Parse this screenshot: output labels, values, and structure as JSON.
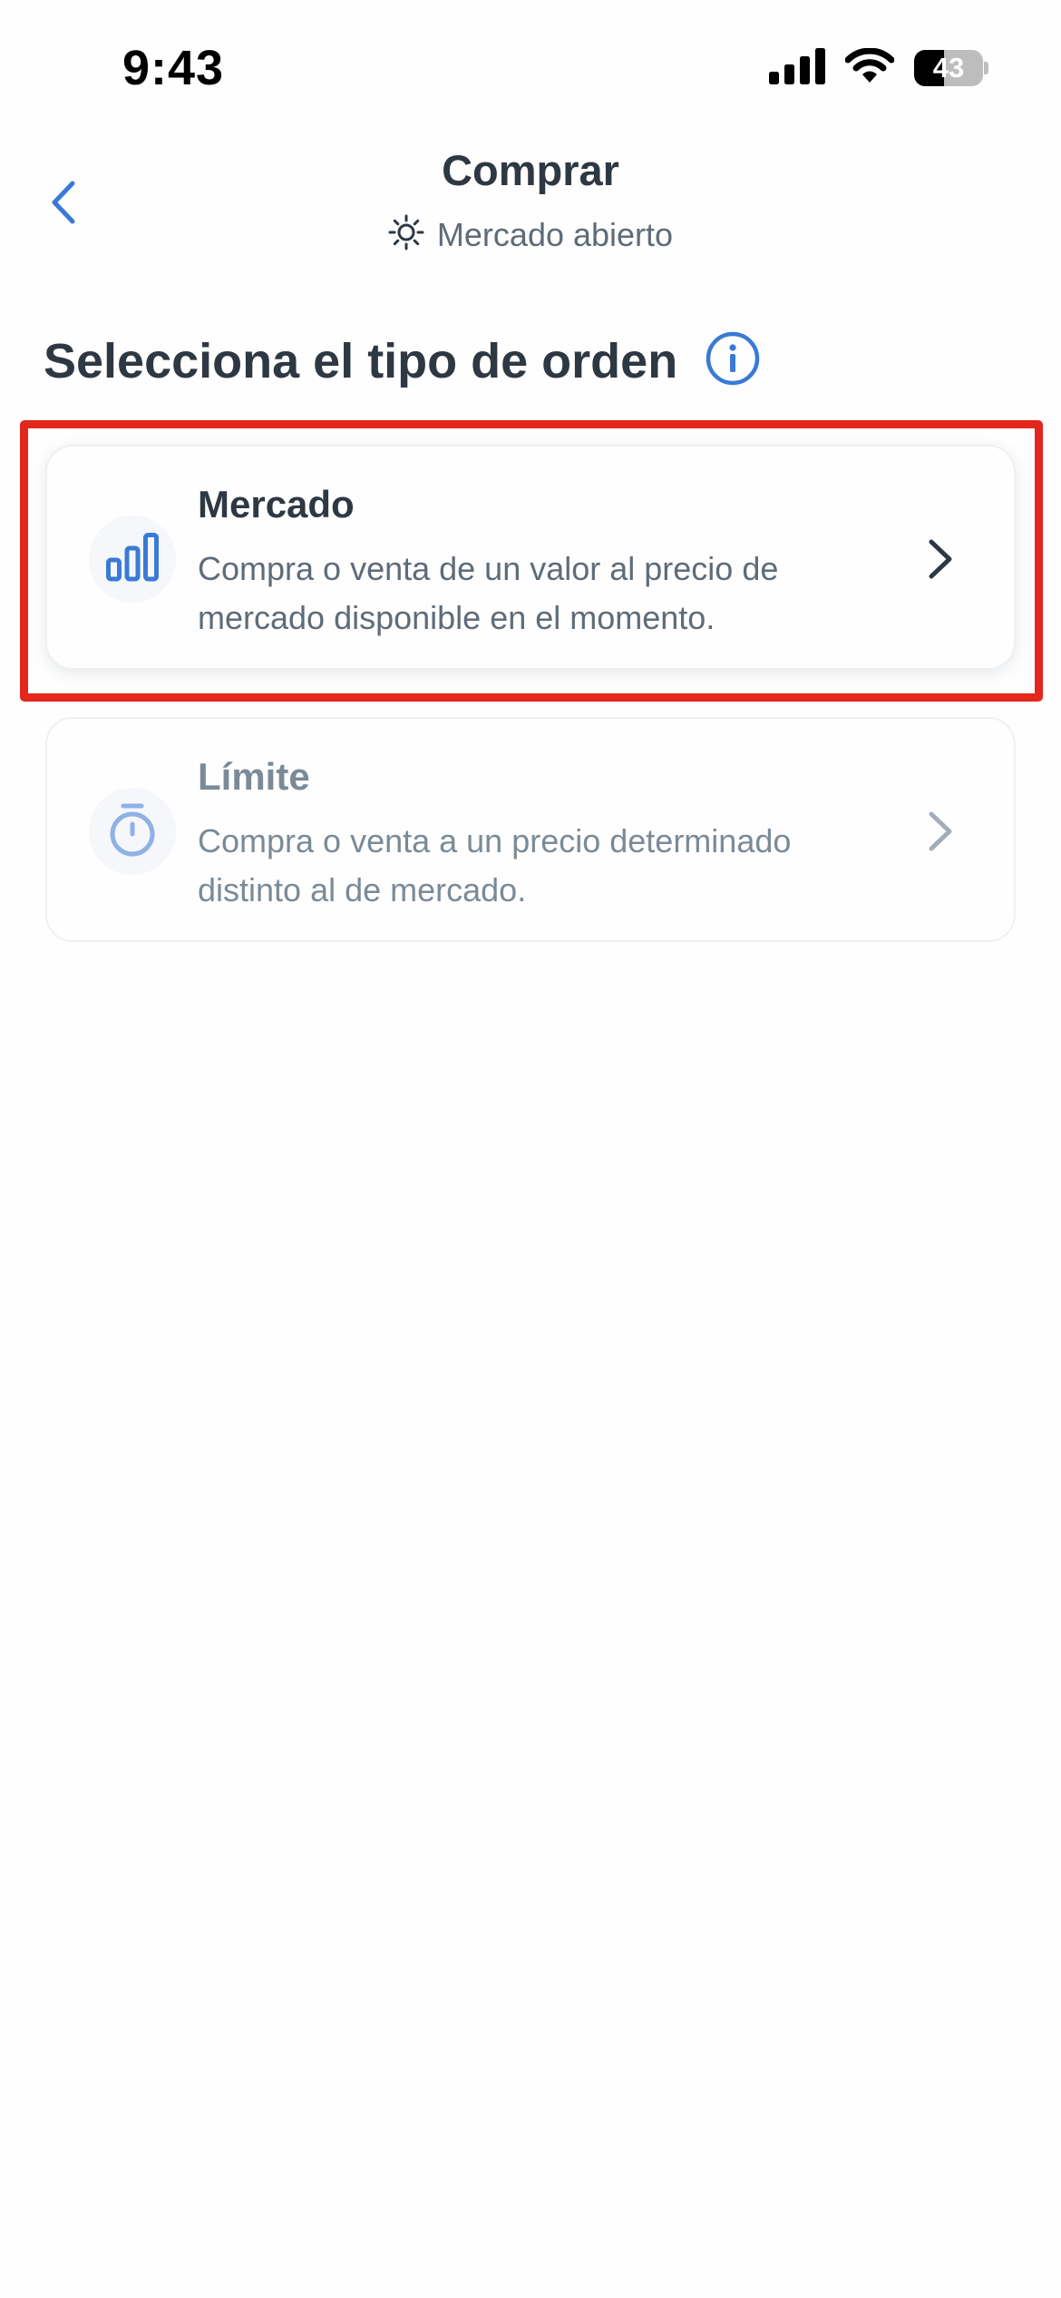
{
  "status_bar": {
    "time": "9:43",
    "battery_level": "43",
    "icons": [
      "cellular-signal-icon",
      "wifi-icon",
      "battery-icon"
    ]
  },
  "header": {
    "title": "Comprar",
    "subtitle": "Mercado abierto",
    "back_icon": "chevron-left-icon",
    "status_icon": "sun-icon"
  },
  "section": {
    "heading": "Selecciona el tipo de orden",
    "info_icon": "info-icon"
  },
  "order_types": [
    {
      "title": "Mercado",
      "description": "Compra o venta de un valor al precio de mercado disponible en el momento.",
      "icon": "bar-chart-icon",
      "highlighted": true
    },
    {
      "title": "Límite",
      "description": "Compra o venta a un precio determinado distinto al de mercado.",
      "icon": "stopwatch-icon",
      "highlighted": false
    }
  ],
  "colors": {
    "accent": "#3a7ad7",
    "highlight": "#e3271c",
    "text_primary": "#2e3843",
    "text_secondary": "#5f6b78",
    "text_muted": "#7b8a97"
  }
}
